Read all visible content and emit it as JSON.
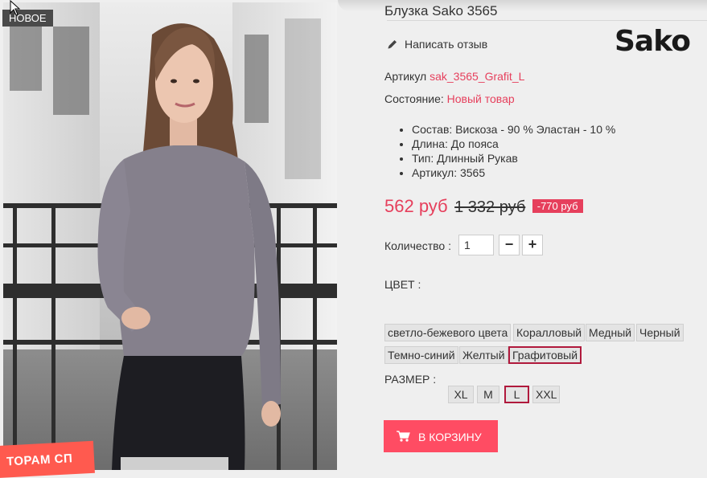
{
  "product": {
    "badge_new": "НОВОЕ",
    "title": "Блузка Sako 3565",
    "write_review": "Написать отзыв",
    "brand_logo": "Sako",
    "article_label": "Артикул",
    "article_value": "sak_3565_Grafit_L",
    "condition_label": "Состояние:",
    "condition_value": "Новый товар",
    "features": [
      "Состав: Вискоза - 90 % Эластан - 10 %",
      "Длина: До пояса",
      "Тип: Длинный Рукав",
      "Артикул: 3565"
    ],
    "price_new": "562 руб",
    "price_old": "1 332 руб",
    "discount": "-770 руб",
    "quantity_label": "Количество :",
    "quantity_value": "1",
    "minus": "−",
    "plus": "+",
    "color_label": "ЦВЕТ :",
    "colors": [
      "светло-бежевого цвета",
      "Коралловый",
      "Медный",
      "Черный",
      "Темно-синий",
      "Желтый",
      "Графитовый"
    ],
    "selected_color": "Графитовый",
    "size_label": "РАЗМЕР :",
    "sizes": [
      "XL",
      "M",
      "L",
      "XXL"
    ],
    "selected_size": "L",
    "add_to_cart": "В КОРЗИНУ",
    "promo_ribbon": "ТОРАМ СП"
  },
  "colors": {
    "accent": "#e63f5c",
    "cart_button": "#ff4c63",
    "selected_border": "#b0193c"
  },
  "icons": [
    "pencil-icon",
    "cart-icon",
    "cursor-arrow-icon"
  ]
}
